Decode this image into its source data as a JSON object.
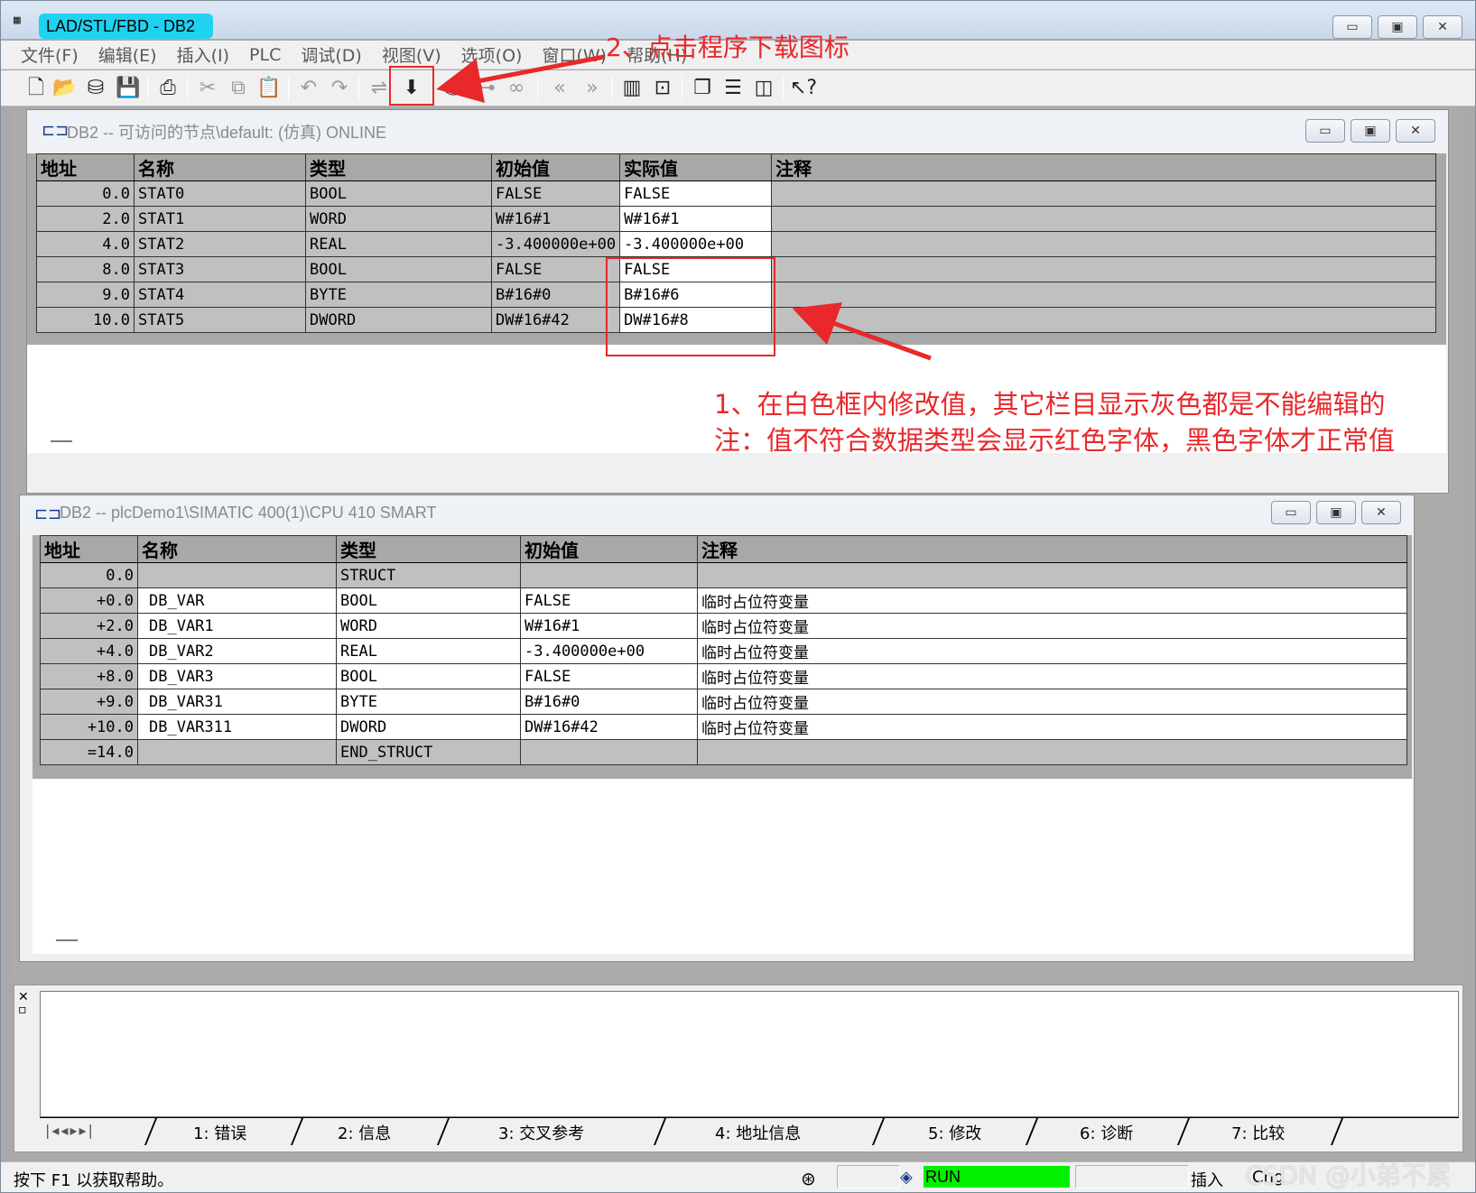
{
  "window": {
    "title": "LAD/STL/FBD  - DB2"
  },
  "menu": [
    "文件(F)",
    "编辑(E)",
    "插入(I)",
    "PLC",
    "调试(D)",
    "视图(V)",
    "选项(O)",
    "窗口(W)",
    "帮助(H)"
  ],
  "online_window": {
    "title": "DB2 -- 可访问的节点\\default:  (仿真)  ONLINE",
    "headers": [
      "地址",
      "名称",
      "类型",
      "初始值",
      "实际值",
      "注释"
    ],
    "rows": [
      {
        "addr": "0.0",
        "name": "STAT0",
        "type": "BOOL",
        "initial": "FALSE",
        "actual": "FALSE",
        "comment": ""
      },
      {
        "addr": "2.0",
        "name": "STAT1",
        "type": "WORD",
        "initial": "W#16#1",
        "actual": "W#16#1",
        "comment": ""
      },
      {
        "addr": "4.0",
        "name": "STAT2",
        "type": "REAL",
        "initial": "-3.400000e+00",
        "actual": "-3.400000e+00",
        "comment": ""
      },
      {
        "addr": "8.0",
        "name": "STAT3",
        "type": "BOOL",
        "initial": "FALSE",
        "actual": "FALSE",
        "comment": ""
      },
      {
        "addr": "9.0",
        "name": "STAT4",
        "type": "BYTE",
        "initial": "B#16#0",
        "actual": "B#16#6",
        "comment": ""
      },
      {
        "addr": "10.0",
        "name": "STAT5",
        "type": "DWORD",
        "initial": "DW#16#42",
        "actual": "DW#16#8",
        "comment": ""
      }
    ]
  },
  "offline_window": {
    "title": "DB2 -- plcDemo1\\SIMATIC 400(1)\\CPU 410 SMART",
    "headers": [
      "地址",
      "名称",
      "类型",
      "初始值",
      "注释"
    ],
    "rows": [
      {
        "addr": "0.0",
        "name": "",
        "type": "STRUCT",
        "initial": "",
        "comment": "",
        "editable": false
      },
      {
        "addr": "+0.0",
        "name": "DB_VAR",
        "type": "BOOL",
        "initial": "FALSE",
        "comment": "临时占位符变量",
        "editable": true
      },
      {
        "addr": "+2.0",
        "name": "DB_VAR1",
        "type": "WORD",
        "initial": "W#16#1",
        "comment": "临时占位符变量",
        "editable": true
      },
      {
        "addr": "+4.0",
        "name": "DB_VAR2",
        "type": "REAL",
        "initial": "-3.400000e+00",
        "comment": "临时占位符变量",
        "editable": true
      },
      {
        "addr": "+8.0",
        "name": "DB_VAR3",
        "type": "BOOL",
        "initial": "FALSE",
        "comment": "临时占位符变量",
        "editable": true
      },
      {
        "addr": "+9.0",
        "name": "DB_VAR31",
        "type": "BYTE",
        "initial": "B#16#0",
        "comment": "临时占位符变量",
        "editable": true
      },
      {
        "addr": "+10.0",
        "name": "DB_VAR311",
        "type": "DWORD",
        "initial": "DW#16#42",
        "comment": "临时占位符变量",
        "editable": true
      },
      {
        "addr": "=14.0",
        "name": "",
        "type": "END_STRUCT",
        "initial": "",
        "comment": "",
        "editable": false
      }
    ]
  },
  "output_tabs": [
    "1: 错误",
    "2: 信息",
    "3: 交叉参考",
    "4: 地址信息",
    "5: 修改",
    "6: 诊断",
    "7: 比较"
  ],
  "status": {
    "help": "按下 F1 以获取帮助。",
    "run": "RUN",
    "insert": "插入",
    "chg": "Chg"
  },
  "watermark": "CSDN @小弟不累",
  "annotations": {
    "step2": "2、点击程序下载图标",
    "step1_line1": "1、在白色框内修改值，其它栏目显示灰色都是不能编辑的",
    "step1_line2": "注：值不符合数据类型会显示红色字体，黑色字体才正常值",
    "color": "#e8282b"
  },
  "colors": {
    "run_green": "#00f000",
    "title_cyan": "#1fd2f0",
    "grid_gray": "#c0c0c0",
    "grid_white": "#ffffff"
  }
}
